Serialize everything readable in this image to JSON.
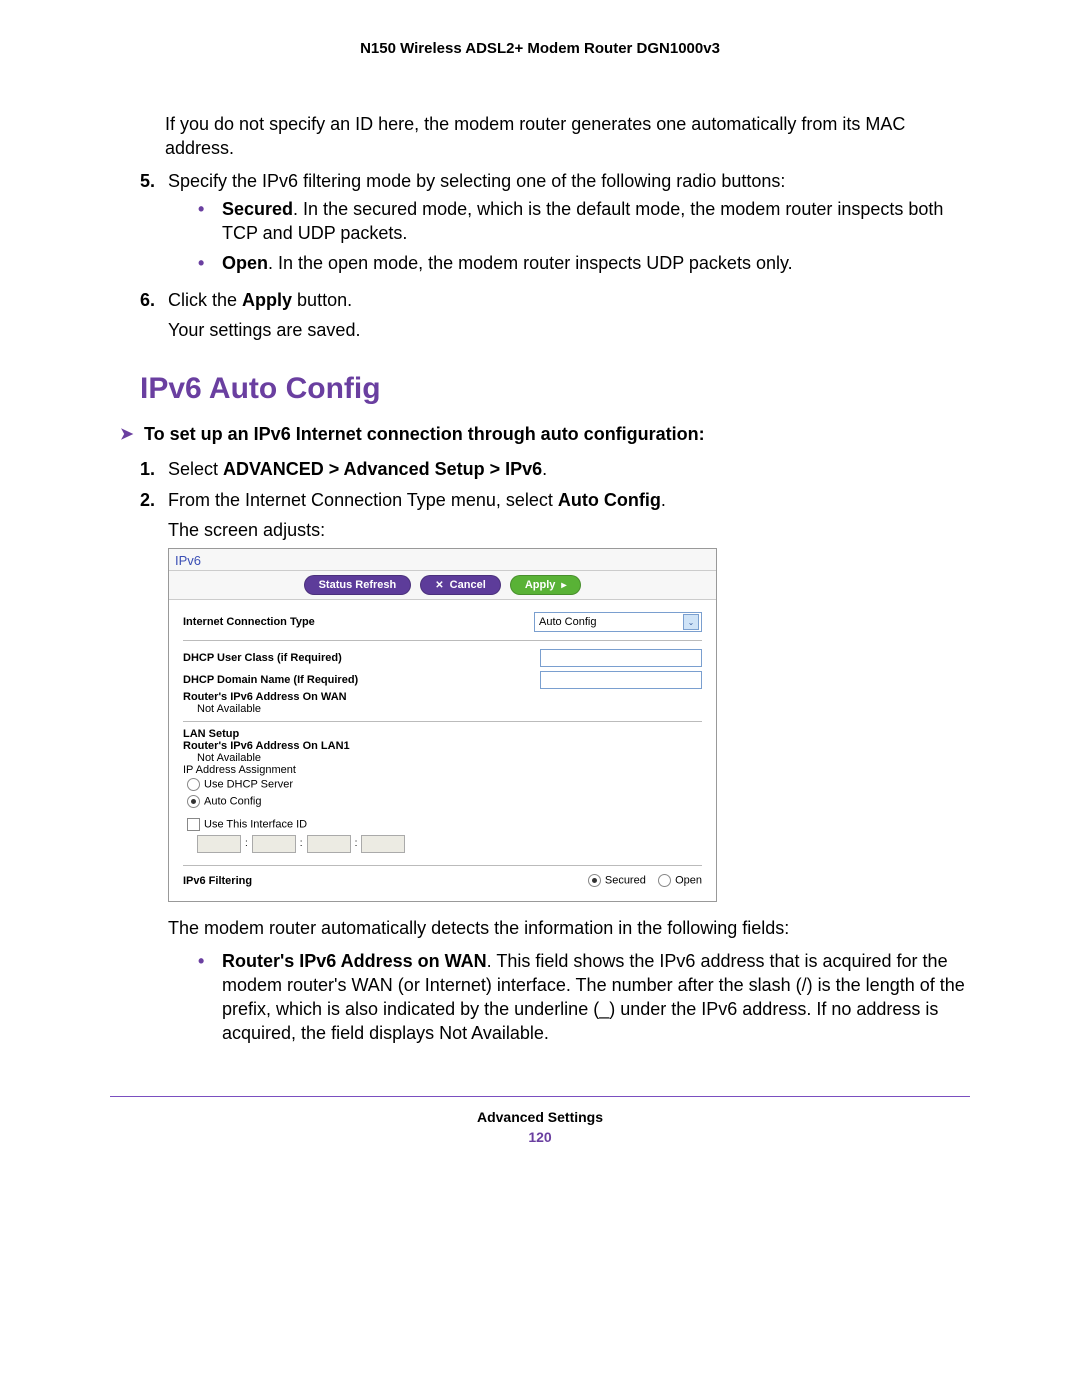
{
  "header": {
    "title": "N150 Wireless ADSL2+ Modem Router DGN1000v3"
  },
  "intro_paragraph": "If you do not specify an ID here, the modem router generates one automatically from its MAC address.",
  "step5": {
    "num": "5.",
    "text": "Specify the IPv6 filtering mode by selecting one of the following radio buttons:",
    "bullets": [
      {
        "bold": "Secured",
        "rest": ". In the secured mode, which is the default mode, the modem router inspects both TCP and UDP packets."
      },
      {
        "bold": "Open",
        "rest": ". In the open mode, the modem router inspects UDP packets only."
      }
    ]
  },
  "step6": {
    "num": "6.",
    "text_prefix": "Click the ",
    "text_bold": "Apply",
    "text_suffix": " button.",
    "after": "Your settings are saved."
  },
  "section_title": "IPv6 Auto Config",
  "task_intro": "To set up an IPv6 Internet connection through auto configuration:",
  "task_steps": {
    "s1": {
      "num": "1.",
      "prefix": "Select ",
      "bold": "ADVANCED > Advanced Setup > IPv6",
      "suffix": "."
    },
    "s2": {
      "num": "2.",
      "prefix": "From the Internet Connection Type menu, select ",
      "bold": "Auto Config",
      "suffix": "."
    },
    "s2_after": "The screen adjusts:"
  },
  "screenshot": {
    "title": "IPv6",
    "buttons": {
      "status_refresh": "Status Refresh",
      "cancel": "Cancel",
      "apply": "Apply"
    },
    "conn_type_label": "Internet Connection Type",
    "conn_type_value": "Auto Config",
    "dhcp_user_class": "DHCP User Class (if Required)",
    "dhcp_domain": "DHCP Domain Name  (If Required)",
    "wan_addr_label": "Router's IPv6 Address On WAN",
    "not_available": "Not Available",
    "lan_setup": "LAN Setup",
    "lan_addr_label": "Router's IPv6 Address On LAN1",
    "ip_assign": "IP Address Assignment",
    "radio_dhcp": "Use DHCP Server",
    "radio_auto": "Auto Config",
    "use_iface": "Use This Interface ID",
    "filtering_label": "IPv6 Filtering",
    "filtering_secured": "Secured",
    "filtering_open": "Open"
  },
  "after_screenshot": {
    "text": "The modem router automatically detects the information in the following fields:",
    "bullet_bold": "Router's IPv6 Address on WAN",
    "bullet_rest": ". This field shows the IPv6 address that is acquired for the modem router's WAN (or Internet) interface. The number after the slash (/) is the length of the prefix, which is also indicated by the underline (_) under the IPv6 address. If no address is acquired, the field displays Not Available."
  },
  "footer": {
    "section": "Advanced Settings",
    "page": "120"
  }
}
